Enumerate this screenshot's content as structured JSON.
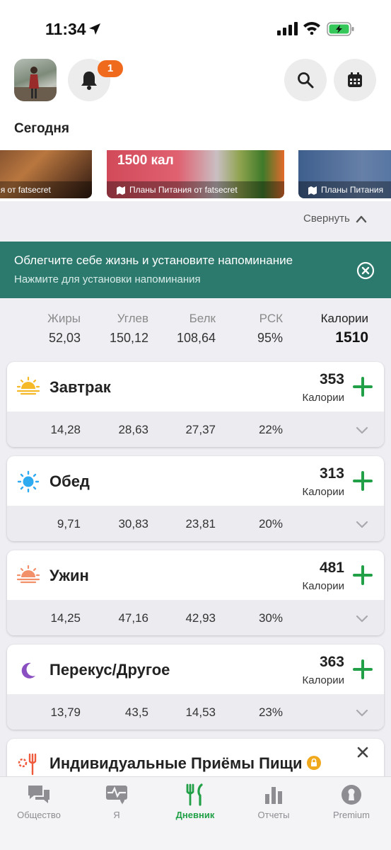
{
  "status_bar": {
    "time": "11:34"
  },
  "header": {
    "notification_count": "1",
    "section_title": "Сегодня"
  },
  "carousel": {
    "items": [
      {
        "calories_text": "",
        "caption": "ия от fatsecret"
      },
      {
        "calories_text": "1500 кал",
        "caption": "Планы Питания от fatsecret"
      },
      {
        "calories_text": "",
        "caption": "Планы Питания"
      }
    ],
    "collapse_label": "Свернуть"
  },
  "reminder_banner": {
    "title": "Облегчите себе жизнь и установите напоминание",
    "subtitle": "Нажмите для установки напоминания"
  },
  "summary": {
    "fat_label": "Жиры",
    "fat": "52,03",
    "carb_label": "Углев",
    "carb": "150,12",
    "protein_label": "Белк",
    "protein": "108,64",
    "rdi_label": "РСК",
    "rdi": "95%",
    "calories_label": "Калории",
    "calories": "1510"
  },
  "meals": [
    {
      "name": "Завтрак",
      "calories": "353",
      "calories_label": "Калории",
      "fat": "14,28",
      "carb": "28,63",
      "protein": "27,37",
      "rdi": "22%"
    },
    {
      "name": "Обед",
      "calories": "313",
      "calories_label": "Калории",
      "fat": "9,71",
      "carb": "30,83",
      "protein": "23,81",
      "rdi": "20%"
    },
    {
      "name": "Ужин",
      "calories": "481",
      "calories_label": "Калории",
      "fat": "14,25",
      "carb": "47,16",
      "protein": "42,93",
      "rdi": "30%"
    },
    {
      "name": "Перекус/Другое",
      "calories": "363",
      "calories_label": "Калории",
      "fat": "13,79",
      "carb": "43,5",
      "protein": "14,53",
      "rdi": "23%"
    }
  ],
  "custom_meals": {
    "title": "Индивидуальные Приёмы Пищи"
  },
  "tabbar": {
    "items": [
      {
        "label": "Общество",
        "icon": "chat-bubbles-icon"
      },
      {
        "label": "Я",
        "icon": "heart-pulse-icon"
      },
      {
        "label": "Дневник",
        "icon": "fork-knife-icon"
      },
      {
        "label": "Отчеты",
        "icon": "bar-chart-icon"
      },
      {
        "label": "Premium",
        "icon": "keyhole-icon"
      }
    ],
    "active_color": "#21a047"
  },
  "colors": {
    "accent_green": "#21a047",
    "banner": "#2c7a6e",
    "badge": "#f06a1e"
  }
}
